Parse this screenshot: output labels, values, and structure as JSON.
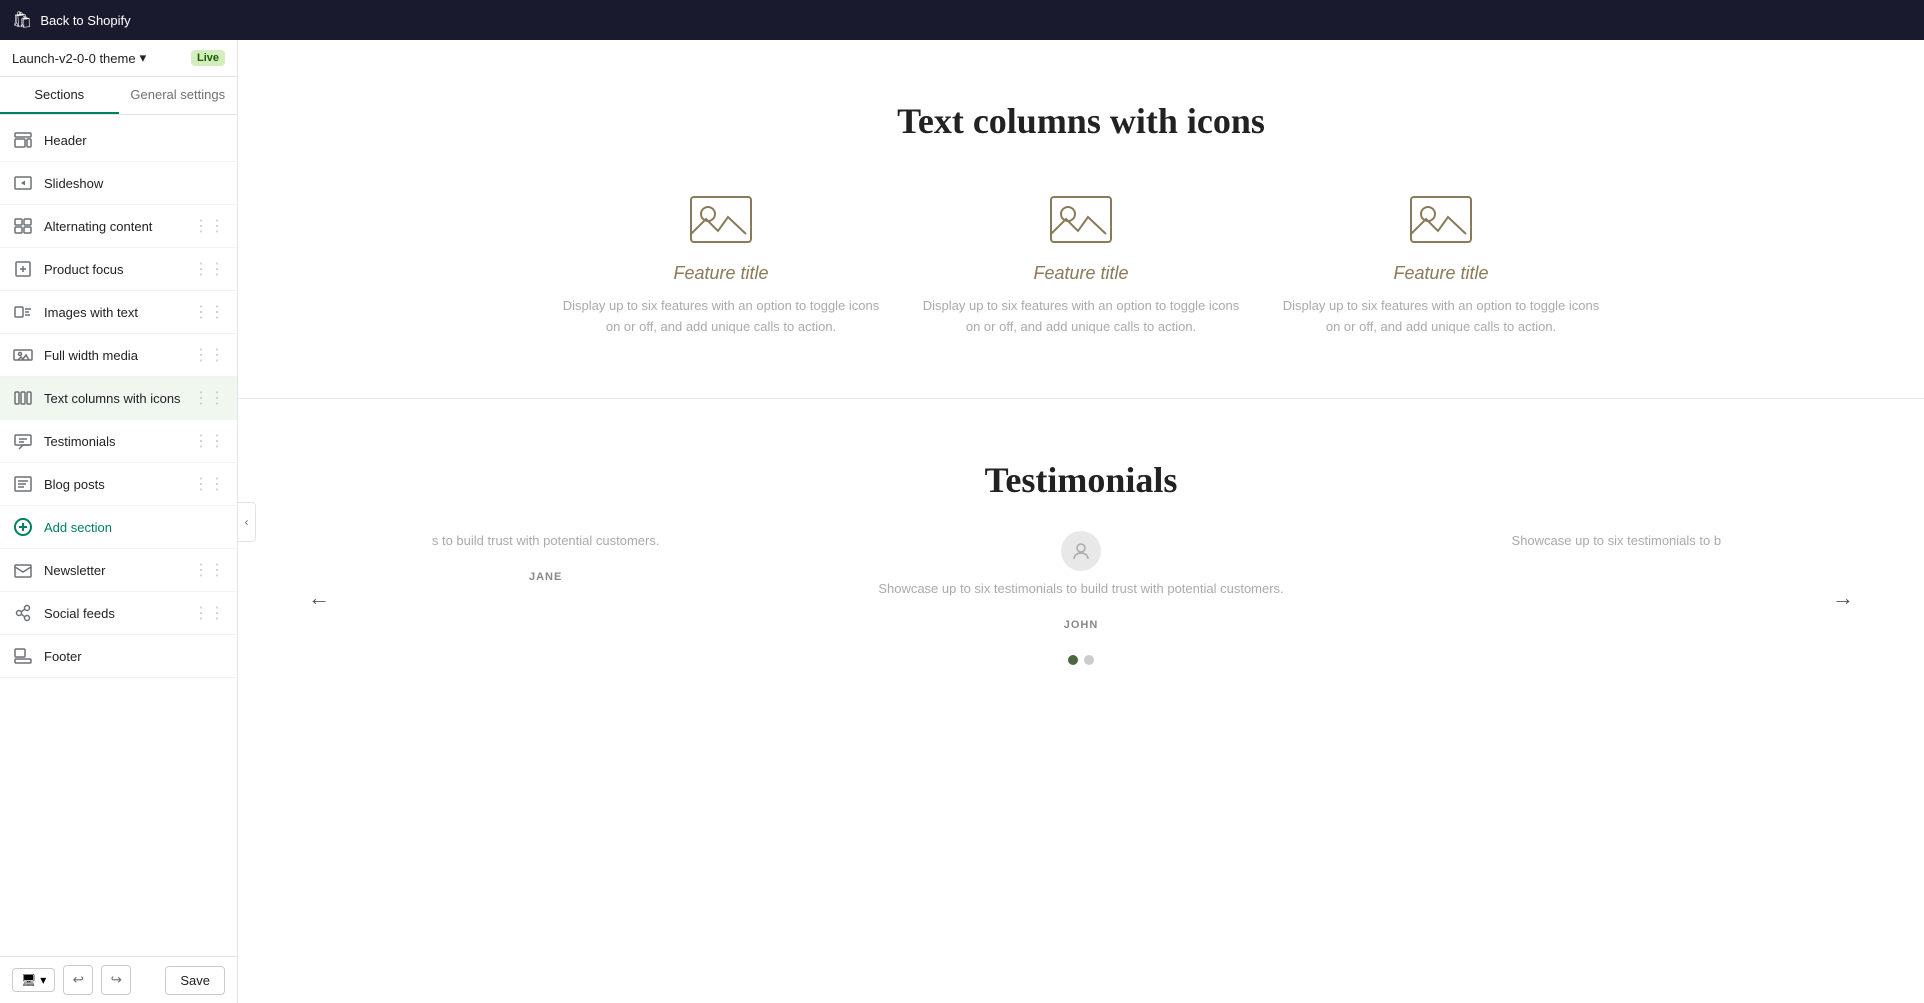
{
  "topbar": {
    "back_label": "Back to Shopify"
  },
  "theme": {
    "name": "Launch-v2-0-0 theme",
    "live_label": "Live"
  },
  "tabs": [
    {
      "id": "sections",
      "label": "Sections",
      "active": true
    },
    {
      "id": "general-settings",
      "label": "General settings",
      "active": false
    }
  ],
  "sidebar": {
    "items": [
      {
        "id": "header",
        "label": "Header",
        "icon": "header-icon",
        "draggable": false
      },
      {
        "id": "slideshow",
        "label": "Slideshow",
        "icon": "slideshow-icon",
        "draggable": false
      },
      {
        "id": "alternating-content",
        "label": "Alternating content",
        "icon": "alternating-icon",
        "draggable": true
      },
      {
        "id": "product-focus",
        "label": "Product focus",
        "icon": "product-icon",
        "draggable": true
      },
      {
        "id": "images-with-text",
        "label": "Images with text",
        "icon": "images-text-icon",
        "draggable": true
      },
      {
        "id": "full-width-media",
        "label": "Full width media",
        "icon": "full-width-icon",
        "draggable": true
      },
      {
        "id": "text-columns-with-icons",
        "label": "Text columns with icons",
        "icon": "text-columns-icon",
        "draggable": true,
        "active": true
      },
      {
        "id": "testimonials",
        "label": "Testimonials",
        "icon": "testimonials-icon",
        "draggable": true
      },
      {
        "id": "blog-posts",
        "label": "Blog posts",
        "icon": "blog-icon",
        "draggable": true
      },
      {
        "id": "add-section",
        "label": "Add section",
        "icon": "add-icon",
        "draggable": false,
        "add": true
      },
      {
        "id": "newsletter",
        "label": "Newsletter",
        "icon": "newsletter-icon",
        "draggable": true
      },
      {
        "id": "social-feeds",
        "label": "Social feeds",
        "icon": "social-icon",
        "draggable": true
      },
      {
        "id": "footer",
        "label": "Footer",
        "icon": "footer-icon",
        "draggable": false
      }
    ]
  },
  "bottom_bar": {
    "save_label": "Save"
  },
  "main": {
    "text_columns_section": {
      "title": "Text columns with icons",
      "columns": [
        {
          "title": "Feature title",
          "description": "Display up to six features with an option to toggle icons on or off, and add unique calls to action."
        },
        {
          "title": "Feature title",
          "description": "Display up to six features with an option to toggle icons on or off, and add unique calls to action."
        },
        {
          "title": "Feature title",
          "description": "Display up to six features with an option to toggle icons on or off, and add unique calls to action."
        }
      ]
    },
    "testimonials_section": {
      "title": "Testimonials",
      "items": [
        {
          "text": "s to build trust with potential customers.",
          "author": "JANE",
          "has_avatar": false
        },
        {
          "text": "Showcase up to six testimonials to build trust with potential customers.",
          "author": "JOHN",
          "has_avatar": true
        },
        {
          "text": "Showcase up to six testimonials to b",
          "author": "",
          "has_avatar": false
        }
      ],
      "dots": [
        {
          "active": true
        },
        {
          "active": false
        }
      ]
    }
  }
}
